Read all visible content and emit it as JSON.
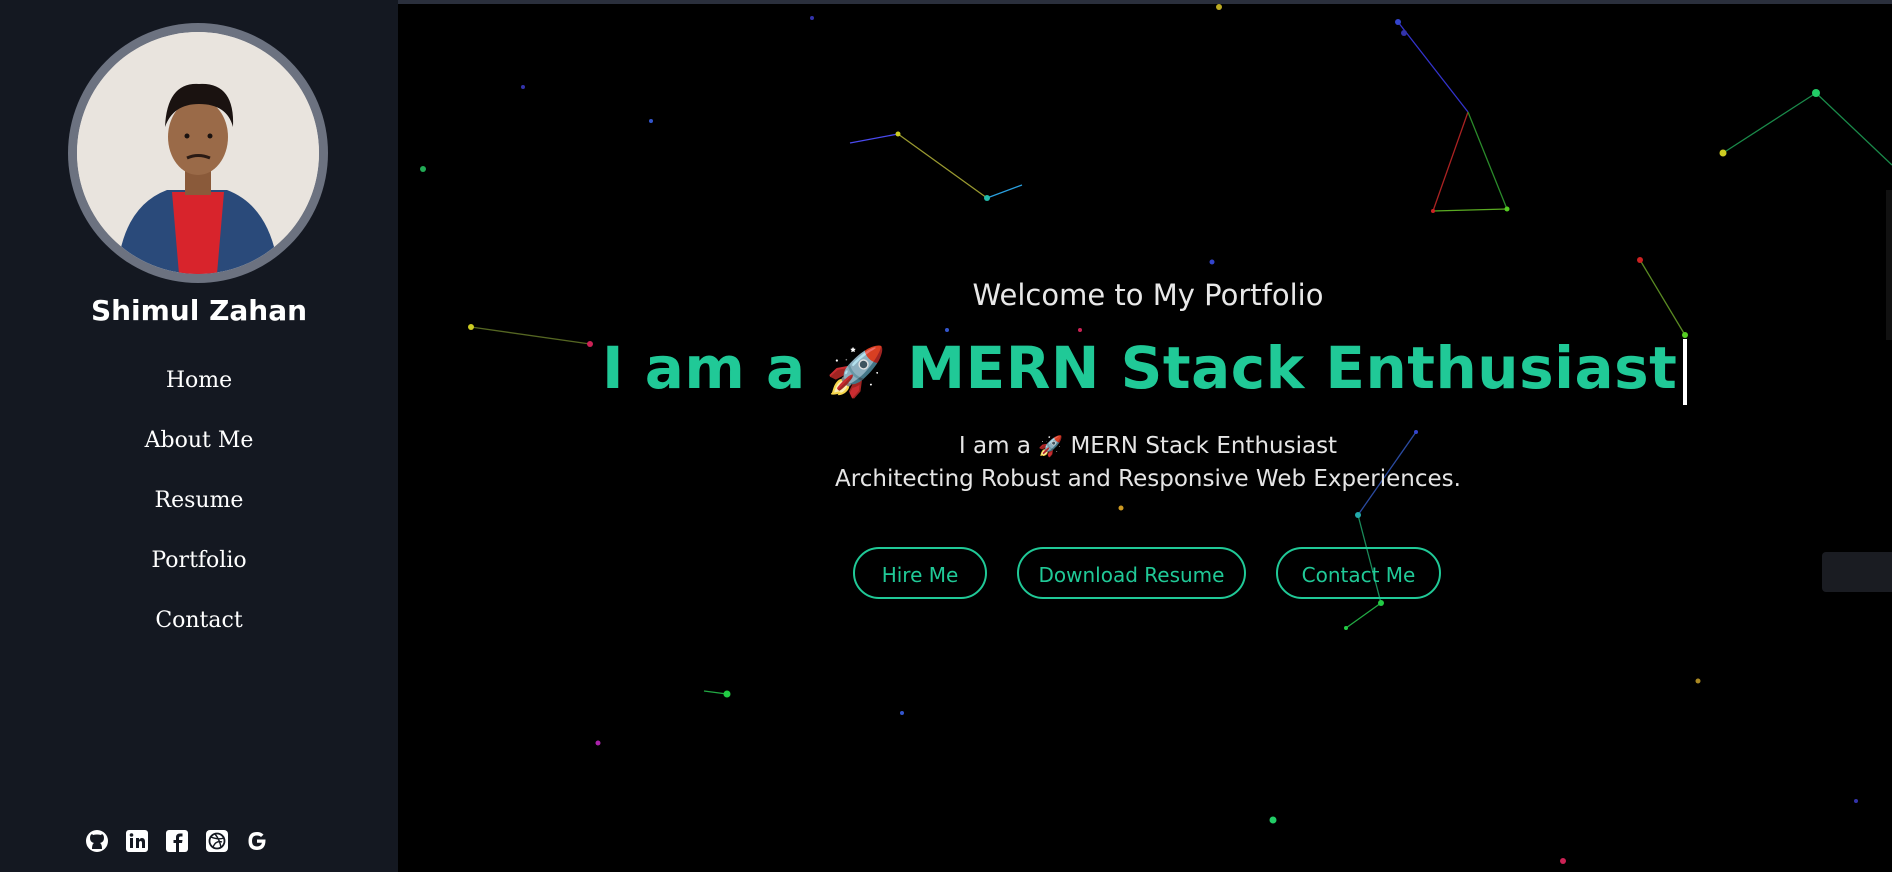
{
  "profile": {
    "name": "Shimul Zahan"
  },
  "nav": {
    "items": [
      {
        "label": "Home"
      },
      {
        "label": "About Me"
      },
      {
        "label": "Resume"
      },
      {
        "label": "Portfolio"
      },
      {
        "label": "Contact"
      }
    ]
  },
  "social": [
    {
      "icon": "github-icon"
    },
    {
      "icon": "linkedin-icon"
    },
    {
      "icon": "facebook-icon"
    },
    {
      "icon": "dribbble-icon"
    },
    {
      "icon": "google-icon"
    }
  ],
  "hero": {
    "welcome": "Welcome to My Portfolio",
    "headline_prefix": "I am a",
    "headline_emoji": "🚀",
    "headline_role": "MERN Stack Enthusiast",
    "sub_prefix": "I am a",
    "sub_emoji": "🚀",
    "sub_role": "MERN Stack Enthusiast",
    "tagline": "Architecting Robust and Responsive Web Experiences."
  },
  "buttons": {
    "hire": "Hire Me",
    "download": "Download Resume",
    "contact": "Contact Me"
  },
  "colors": {
    "accent": "#20c997",
    "sidebar_bg": "#141821",
    "main_bg": "#000000"
  }
}
